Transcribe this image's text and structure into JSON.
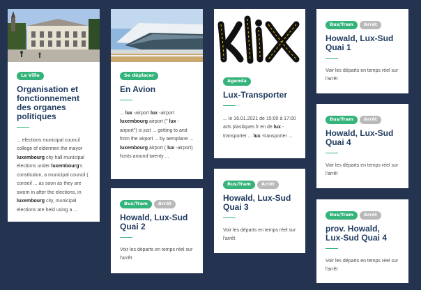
{
  "cards": [
    {
      "badge": "La Ville",
      "title": "Organisation et fonctionnement des organes politiques",
      "excerpt_parts": [
        {
          "t": "... elections municipal council college of eldermen the mayor ",
          "b": false
        },
        {
          "t": "luxembourg",
          "b": true
        },
        {
          "t": " city hall municipal elections under ",
          "b": false
        },
        {
          "t": "luxembourg",
          "b": true
        },
        {
          "t": "'s constitution, a municipal council ( conseil ... as soon as they are sworn in after the elections, in ",
          "b": false
        },
        {
          "t": "luxembourg",
          "b": true
        },
        {
          "t": " city, municipal elections are held using a ...",
          "b": false
        }
      ]
    },
    {
      "badge": "Se déplacer",
      "title": "En Avion",
      "excerpt_parts": [
        {
          "t": "... ",
          "b": false
        },
        {
          "t": "lux",
          "b": true
        },
        {
          "t": " -airport ",
          "b": false
        },
        {
          "t": "lux",
          "b": true
        },
        {
          "t": " -airport ",
          "b": false
        },
        {
          "t": "luxembourg",
          "b": true
        },
        {
          "t": " airport (\" ",
          "b": false
        },
        {
          "t": "lux",
          "b": true
        },
        {
          "t": " -airport\") is  just ... getting to and from the airport ... by aeroplane ... ",
          "b": false
        },
        {
          "t": "luxembourg",
          "b": true
        },
        {
          "t": " airport ( ",
          "b": false
        },
        {
          "t": "lux",
          "b": true
        },
        {
          "t": " -airport) hosts around twenty ...",
          "b": false
        }
      ]
    },
    {
      "badges": [
        "Bus/Tram",
        "Arrêt"
      ],
      "title": "Howald, Lux-Sud Quai 2",
      "text": "Voir les départs en temps réel sur l'arrêt"
    },
    {
      "badge": "Agenda",
      "title": "Lux-Transporter",
      "excerpt_parts": [
        {
          "t": "... le 16.01.2021 de 15:00 à 17:00 arts plastiques fr en de ",
          "b": false
        },
        {
          "t": "lux",
          "b": true
        },
        {
          "t": " -transporter ... ",
          "b": false
        },
        {
          "t": "lux",
          "b": true
        },
        {
          "t": " -transporter ...",
          "b": false
        }
      ]
    },
    {
      "badges": [
        "Bus/Tram",
        "Arrêt"
      ],
      "title": "Howald, Lux-Sud Quai 3",
      "text": "Voir les départs en temps réel sur l'arrêt"
    },
    {
      "badges": [
        "Bus/Tram",
        "Arrêt"
      ],
      "title": "Howald, Lux-Sud Quai 1",
      "text": "Voir les départs en temps réel sur l'arrêt"
    },
    {
      "badges": [
        "Bus/Tram",
        "Arrêt"
      ],
      "title": "Howald, Lux-Sud Quai 4",
      "text": "Voir les départs en temps réel sur l'arrêt"
    },
    {
      "badges": [
        "Bus/Tram",
        "Arrêt"
      ],
      "title": "prov. Howald, Lux-Sud Quai 4",
      "text": "Voir les départs en temps réel sur l'arrêt"
    }
  ],
  "colors": {
    "page_background": "#243450",
    "badge_green": "#34b37a",
    "badge_grey": "#b9b9b9",
    "title_blue": "#1f3a5f"
  },
  "icons": [
    "town-hall-photo",
    "airport-terminal-photo",
    "klix-logo"
  ]
}
